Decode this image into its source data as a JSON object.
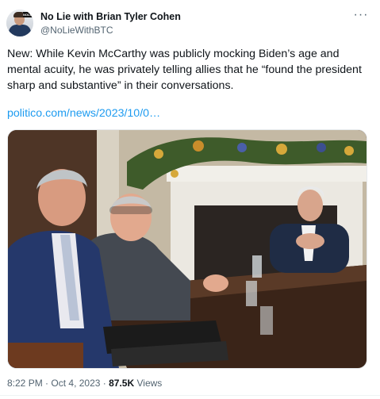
{
  "author": {
    "name": "No Lie with Brian Tyler Cohen",
    "handle": "@NoLieWithBTC",
    "avatar_badge": "NOLIE"
  },
  "tweet": {
    "text": "New: While Kevin McCarthy was publicly mocking Biden’s age and mental acuity, he was privately telling allies that he “found the president sharp and substantive” in their conversations.",
    "link": "politico.com/news/2023/10/0…",
    "more_icon": "ellipsis-icon"
  },
  "meta": {
    "time": "8:22 PM",
    "separator": "·",
    "date": "Oct 4, 2023",
    "views_count": "87.5K",
    "views_label": "Views"
  }
}
